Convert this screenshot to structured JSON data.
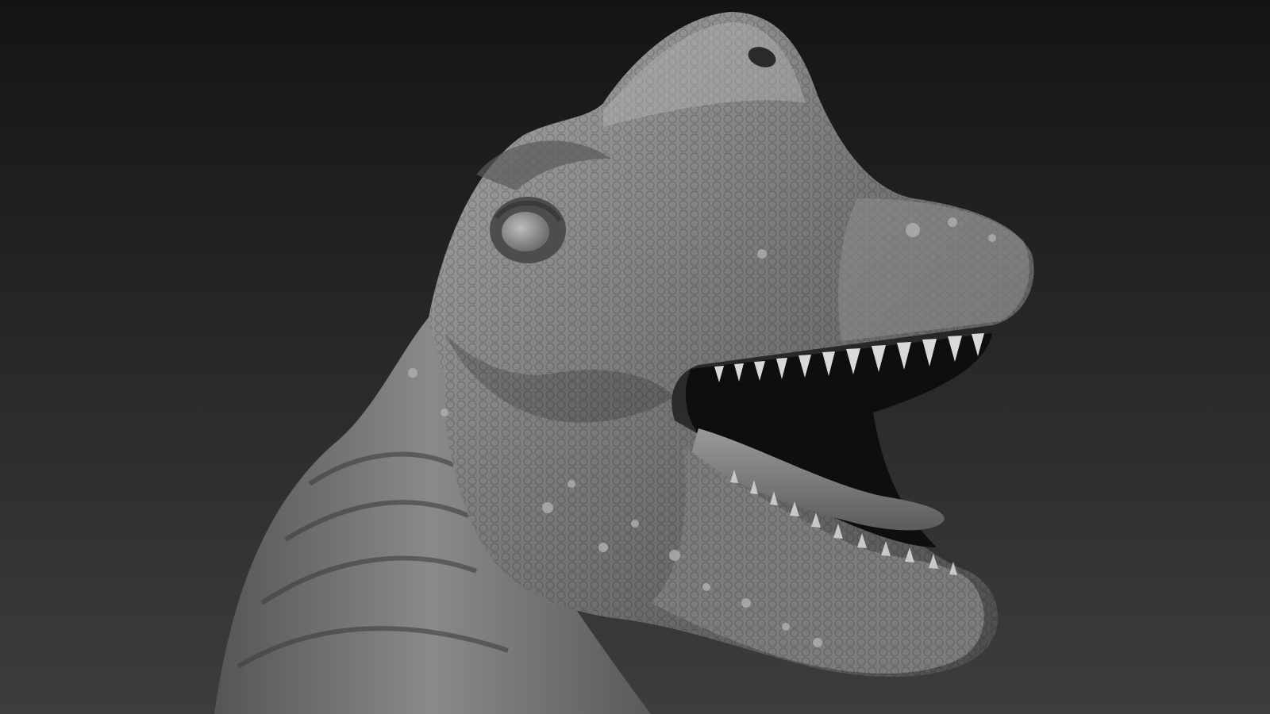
{
  "scene": {
    "subject": "sculpted-dinosaur-head",
    "style": "grayscale-clay-render",
    "colors": {
      "background_top": "#141414",
      "background_bottom": "#3d3d3d",
      "skin_light": "#a8a8a8",
      "skin_mid": "#7a7a7a",
      "skin_dark": "#4a4a4a",
      "mouth_interior": "#0e0e0e",
      "teeth": "#d9d9d9",
      "tongue": "#858585"
    },
    "icons": []
  }
}
